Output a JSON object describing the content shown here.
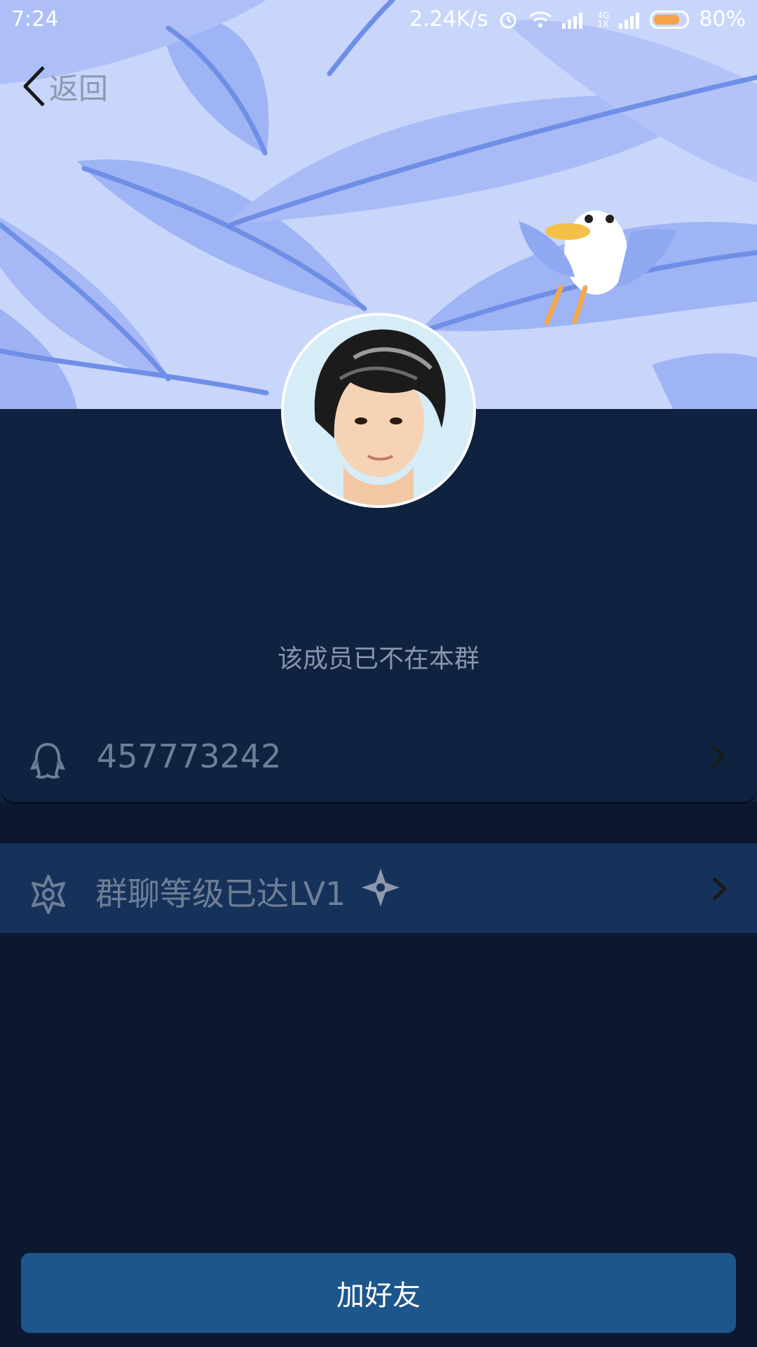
{
  "status_bar": {
    "time": "7:24",
    "speed": "2.24K/s",
    "network_small_top": "4G",
    "network_small_bottom": "1X",
    "battery": "80%"
  },
  "nav": {
    "back_label": "返回"
  },
  "profile": {
    "notice": "该成员已不在本群"
  },
  "rows": {
    "qq_number": "457773242",
    "level_text": "群聊等级已达LV1"
  },
  "footer": {
    "add_friend_label": "加好友"
  },
  "colors": {
    "banner_bg": "#c9d6fb",
    "profile_bg": "#0f2240",
    "page_bg": "#0b1830",
    "level_row_bg": "#17325a",
    "button_bg": "#1d568b",
    "battery_fill": "#f7a24a"
  },
  "icons": [
    "chevron-left-icon",
    "alarm-icon",
    "wifi-icon",
    "signal-icon",
    "battery-icon",
    "qq-penguin-icon",
    "star-badge-icon",
    "diamond-star-icon",
    "chevron-right-icon"
  ]
}
